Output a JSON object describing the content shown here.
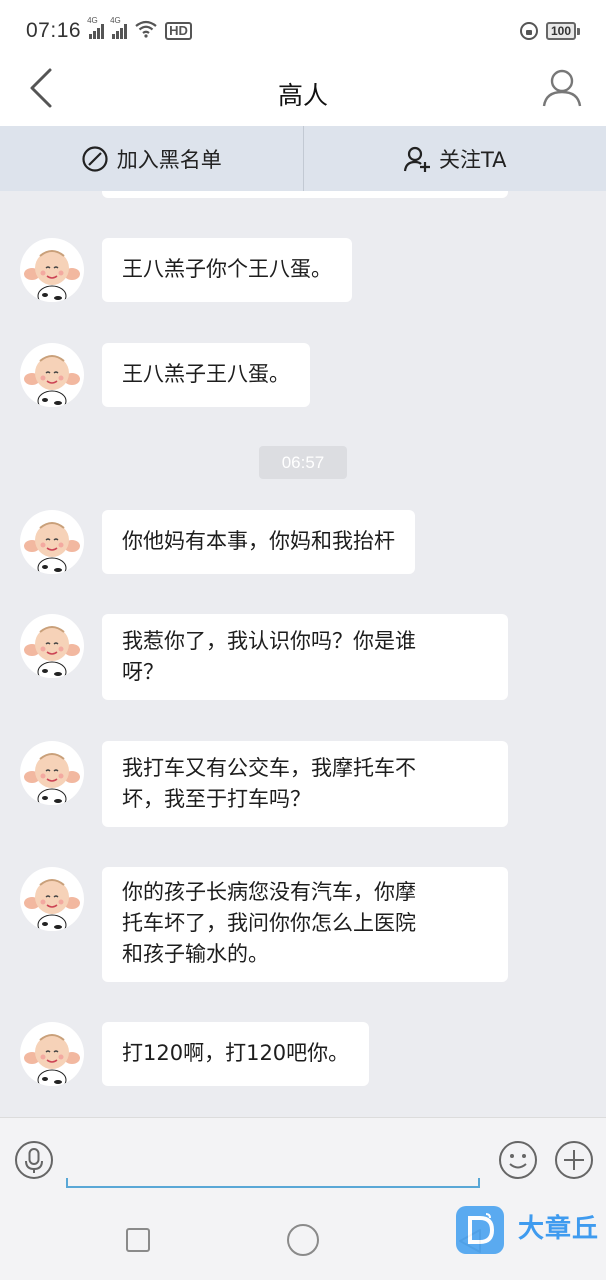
{
  "status_bar": {
    "time": "07:16",
    "network_1": "4G",
    "network_2": "4G",
    "hd_label": "HD",
    "battery": "100"
  },
  "header": {
    "title": "高人"
  },
  "actions": {
    "blacklist_label": "加入黑名单",
    "follow_label": "关注TA"
  },
  "messages": [
    {
      "text": "王八羔子你个王八蛋。"
    },
    {
      "text": "王八羔子王八蛋。"
    },
    {
      "text": "你他妈有本事，你妈和我抬杆"
    },
    {
      "text": "我惹你了，我认识你吗？你是谁\n呀？"
    },
    {
      "text": "我打车又有公交车，我摩托车不\n坏，我至于打车吗？"
    },
    {
      "text": "你的孩子长病您没有汽车，你摩\n托车坏了，我问你你怎么上医院\n和孩子输水的。"
    },
    {
      "text": "打120啊，打120吧你。"
    }
  ],
  "time_separator": "06:57",
  "input": {
    "value": "",
    "placeholder": ""
  },
  "watermark": {
    "text": "大章丘"
  },
  "colors": {
    "chat_bg": "#ebecf0",
    "action_bar_bg": "#dde3ec",
    "input_underline": "#59a7d6",
    "watermark": "#3f9bef"
  },
  "icons": {
    "back": "chevron-left-icon",
    "profile": "user-icon",
    "blacklist": "block-icon",
    "follow": "add-user-icon",
    "mic": "microphone-icon",
    "emoji": "smiley-icon",
    "plus": "plus-icon"
  }
}
